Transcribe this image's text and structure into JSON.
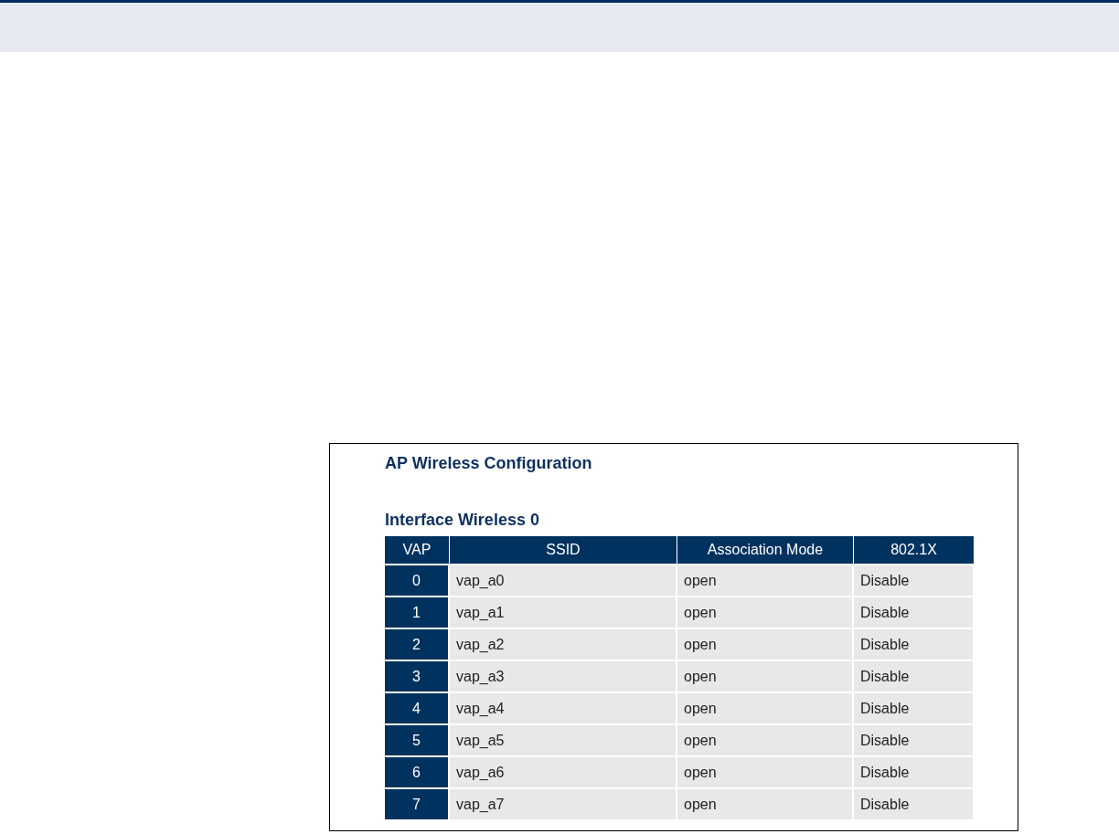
{
  "title": "AP Wireless Configuration",
  "interface": {
    "heading": "Interface Wireless 0",
    "columns": [
      "VAP",
      "SSID",
      "Association Mode",
      "802.1X"
    ],
    "rows": [
      {
        "vap": "0",
        "ssid": "vap_a0",
        "mode": "open",
        "dot1x": "Disable"
      },
      {
        "vap": "1",
        "ssid": "vap_a1",
        "mode": "open",
        "dot1x": "Disable"
      },
      {
        "vap": "2",
        "ssid": "vap_a2",
        "mode": "open",
        "dot1x": "Disable"
      },
      {
        "vap": "3",
        "ssid": "vap_a3",
        "mode": "open",
        "dot1x": "Disable"
      },
      {
        "vap": "4",
        "ssid": "vap_a4",
        "mode": "open",
        "dot1x": "Disable"
      },
      {
        "vap": "5",
        "ssid": "vap_a5",
        "mode": "open",
        "dot1x": "Disable"
      },
      {
        "vap": "6",
        "ssid": "vap_a6",
        "mode": "open",
        "dot1x": "Disable"
      },
      {
        "vap": "7",
        "ssid": "vap_a7",
        "mode": "open",
        "dot1x": "Disable"
      }
    ]
  }
}
